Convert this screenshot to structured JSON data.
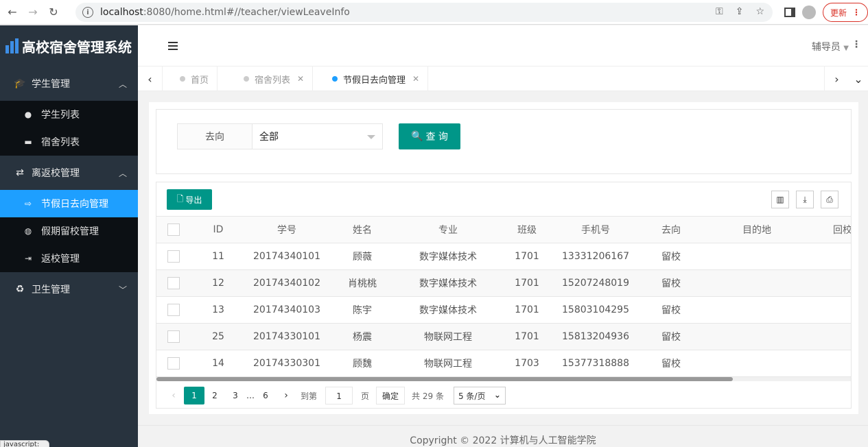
{
  "browser": {
    "url_host": "localhost",
    "url_path": ":8080/home.html#//teacher/viewLeaveInfo",
    "update_label": "更新",
    "status_text": "javascript:"
  },
  "app": {
    "title": "高校宿舍管理系统",
    "user": "辅导员"
  },
  "sidebar": {
    "groups": [
      {
        "label": "学生管理",
        "items": [
          {
            "label": "学生列表"
          },
          {
            "label": "宿舍列表"
          }
        ]
      },
      {
        "label": "离返校管理",
        "items": [
          {
            "label": "节假日去向管理"
          },
          {
            "label": "假期留校管理"
          },
          {
            "label": "返校管理"
          }
        ]
      },
      {
        "label": "卫生管理"
      }
    ]
  },
  "tabs": [
    {
      "label": "首页"
    },
    {
      "label": "宿舍列表"
    },
    {
      "label": "节假日去向管理"
    }
  ],
  "search": {
    "field_label": "去向",
    "select_value": "全部",
    "query_label": "查 询"
  },
  "toolbar": {
    "export_label": "导出"
  },
  "table": {
    "headers": [
      "ID",
      "学号",
      "姓名",
      "专业",
      "班级",
      "手机号",
      "去向",
      "目的地",
      "回校"
    ],
    "rows": [
      [
        "11",
        "20174340101",
        "顾薇",
        "数字媒体技术",
        "1701",
        "13331206167",
        "留校",
        "",
        ""
      ],
      [
        "12",
        "20174340102",
        "肖桃桃",
        "数字媒体技术",
        "1701",
        "15207248019",
        "留校",
        "",
        ""
      ],
      [
        "13",
        "20174340103",
        "陈宇",
        "数字媒体技术",
        "1701",
        "15803104295",
        "留校",
        "",
        ""
      ],
      [
        "25",
        "20174330101",
        "杨震",
        "物联网工程",
        "1701",
        "15813204936",
        "留校",
        "",
        ""
      ],
      [
        "14",
        "20174330301",
        "顾魏",
        "物联网工程",
        "1703",
        "15377318888",
        "留校",
        "",
        ""
      ]
    ]
  },
  "pager": {
    "pages": [
      "1",
      "2",
      "3",
      "…",
      "6"
    ],
    "goto_label": "到第",
    "goto_value": "1",
    "page_unit": "页",
    "confirm_label": "确定",
    "total_label": "共 29 条",
    "size_label": "5 条/页"
  },
  "footer": {
    "text": "Copyright © 2022 计算机与人工智能学院"
  },
  "colors": {
    "accent": "#009688",
    "active_blue": "#1e9fff",
    "sidebar": "#28333e"
  }
}
